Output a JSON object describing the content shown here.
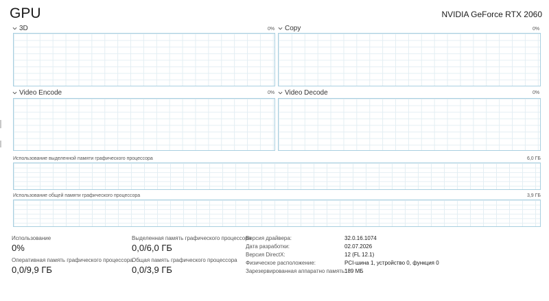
{
  "header": {
    "title": "GPU",
    "device": "NVIDIA GeForce RTX 2060"
  },
  "engines": [
    {
      "label": "3D",
      "pct": "0%"
    },
    {
      "label": "Copy",
      "pct": "0%"
    },
    {
      "label": "Video Encode",
      "pct": "0%"
    },
    {
      "label": "Video Decode",
      "pct": "0%"
    }
  ],
  "dedicated_memory": {
    "label": "Использование выделенной памяти графического процессора",
    "max": "6,0 ГБ"
  },
  "shared_memory": {
    "label": "Использование общей памяти графического процессора",
    "max": "3,9 ГБ"
  },
  "stats": {
    "utilization": {
      "label": "Использование",
      "value": "0%"
    },
    "dedicated": {
      "label": "Выделенная память графического процессора",
      "value": "0,0/6,0 ГБ"
    },
    "gpu_memory": {
      "label": "Оперативная память графического процессора",
      "value": "0,0/9,9 ГБ"
    },
    "shared": {
      "label": "Общая память графического процессора",
      "value": "0,0/3,9 ГБ"
    }
  },
  "info": [
    {
      "key": "Версия драйвера:",
      "value": "32.0.16.1074"
    },
    {
      "key": "Дата разработки:",
      "value": "02.07.2026"
    },
    {
      "key": "Версия DirectX:",
      "value": "12 (FL 12.1)"
    },
    {
      "key": "Физическое расположение:",
      "value": "PCI-шина 1, устройство 0, функция 0"
    },
    {
      "key": "Зарезервированная аппаратно память:",
      "value": "189 МБ"
    }
  ],
  "colors": {
    "graph_border": "#a8cfe0",
    "grid": "#e3eef3"
  }
}
